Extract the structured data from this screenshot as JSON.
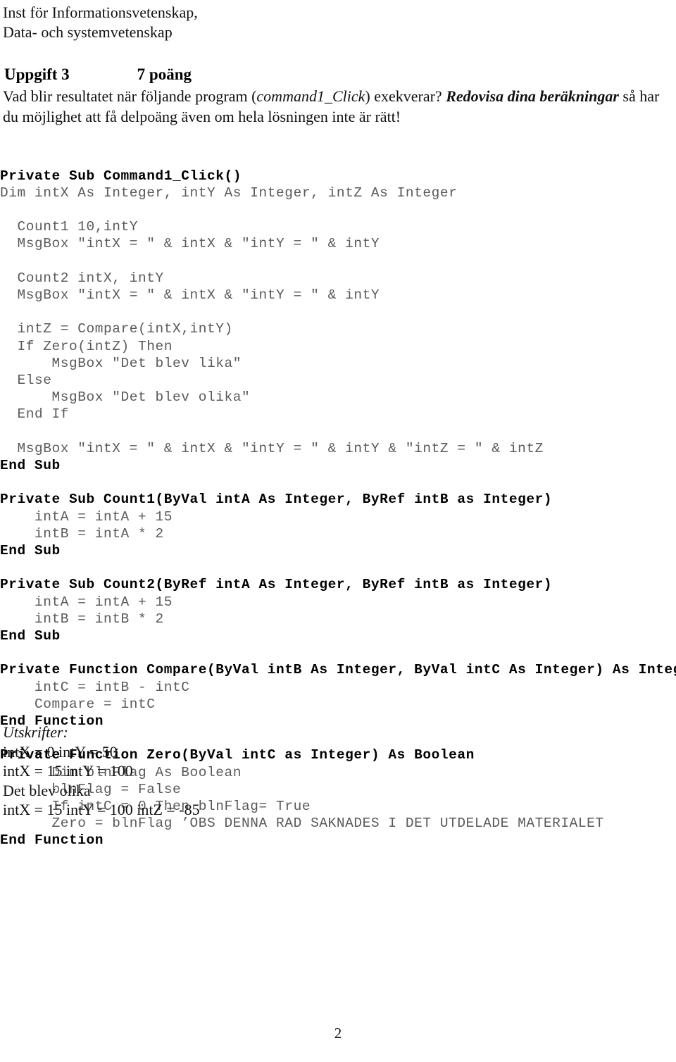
{
  "document": {
    "institution": {
      "line1": "Inst för Informationsvetenskap,",
      "line2": "Data- och systemvetenskap"
    },
    "task": {
      "label": "Uppgift 3",
      "points": "7 poäng"
    },
    "intro": {
      "part1": "Vad blir resultatet när följande program (",
      "italic1": "command1_Click",
      "part2": ") exekverar? ",
      "bold_italic": "Redovisa dina beräkningar",
      "part3": " så har du möjlighet att få delpoäng även om hela lösningen inte är rätt!"
    },
    "code": {
      "lines": [
        {
          "text": "Private Sub Command1_Click()",
          "style": "kw"
        },
        {
          "text": "Dim intX As Integer, intY As Integer, intZ As Integer",
          "style": "body"
        },
        {
          "text": "",
          "style": "blank"
        },
        {
          "text": "  Count1 10,intY",
          "style": "body"
        },
        {
          "text": "  MsgBox \"intX = \" & intX & \"intY = \" & intY",
          "style": "body"
        },
        {
          "text": "",
          "style": "blank"
        },
        {
          "text": "  Count2 intX, intY",
          "style": "body"
        },
        {
          "text": "  MsgBox \"intX = \" & intX & \"intY = \" & intY",
          "style": "body"
        },
        {
          "text": "",
          "style": "blank"
        },
        {
          "text": "  intZ = Compare(intX,intY)",
          "style": "body"
        },
        {
          "text": "  If Zero(intZ) Then",
          "style": "body"
        },
        {
          "text": "      MsgBox \"Det blev lika\"",
          "style": "body"
        },
        {
          "text": "  Else",
          "style": "body"
        },
        {
          "text": "      MsgBox \"Det blev olika\"",
          "style": "body"
        },
        {
          "text": "  End If",
          "style": "body"
        },
        {
          "text": "",
          "style": "blank"
        },
        {
          "text": "  MsgBox \"intX = \" & intX & \"intY = \" & intY & \"intZ = \" & intZ",
          "style": "body"
        },
        {
          "text": "End Sub",
          "style": "kw"
        },
        {
          "text": "",
          "style": "blank"
        },
        {
          "text": "Private Sub Count1(ByVal intA As Integer, ByRef intB as Integer)",
          "style": "kw"
        },
        {
          "text": "    intA = intA + 15",
          "style": "body"
        },
        {
          "text": "    intB = intA * 2",
          "style": "body"
        },
        {
          "text": "End Sub",
          "style": "kw"
        },
        {
          "text": "",
          "style": "blank"
        },
        {
          "text": "Private Sub Count2(ByRef intA As Integer, ByRef intB as Integer)",
          "style": "kw"
        },
        {
          "text": "    intA = intA + 15",
          "style": "body"
        },
        {
          "text": "    intB = intB * 2",
          "style": "body"
        },
        {
          "text": "End Sub",
          "style": "kw"
        },
        {
          "text": "",
          "style": "blank"
        },
        {
          "text": "Private Function Compare(ByVal intB As Integer, ByVal intC As Integer) As Integer",
          "style": "kw"
        },
        {
          "text": "    intC = intB - intC",
          "style": "body"
        },
        {
          "text": "    Compare = intC",
          "style": "body"
        },
        {
          "text": "End Function",
          "style": "kw"
        },
        {
          "text": "",
          "style": "blank"
        },
        {
          "text": "Private Function Zero(ByVal intC as Integer) As Boolean",
          "style": "kw"
        },
        {
          "text": "      Dim blnFlag As Boolean",
          "style": "body"
        },
        {
          "text": "      blnFlag = False",
          "style": "body"
        },
        {
          "text": "      If intC = 0 Then blnFlag= True",
          "style": "body"
        },
        {
          "text": "      Zero = blnFlag ’OBS DENNA RAD SAKNADES I DET UTDELADE MATERIALET",
          "style": "body"
        },
        {
          "text": "End Function",
          "style": "kw"
        }
      ]
    },
    "output": {
      "title": "Utskrifter:",
      "lines": [
        "intX = 0 intY = 50",
        "intX = 15 intY = 100",
        "Det blev olika",
        "intX = 15 intY = 100 intZ = -85"
      ]
    },
    "page_number": "2"
  }
}
